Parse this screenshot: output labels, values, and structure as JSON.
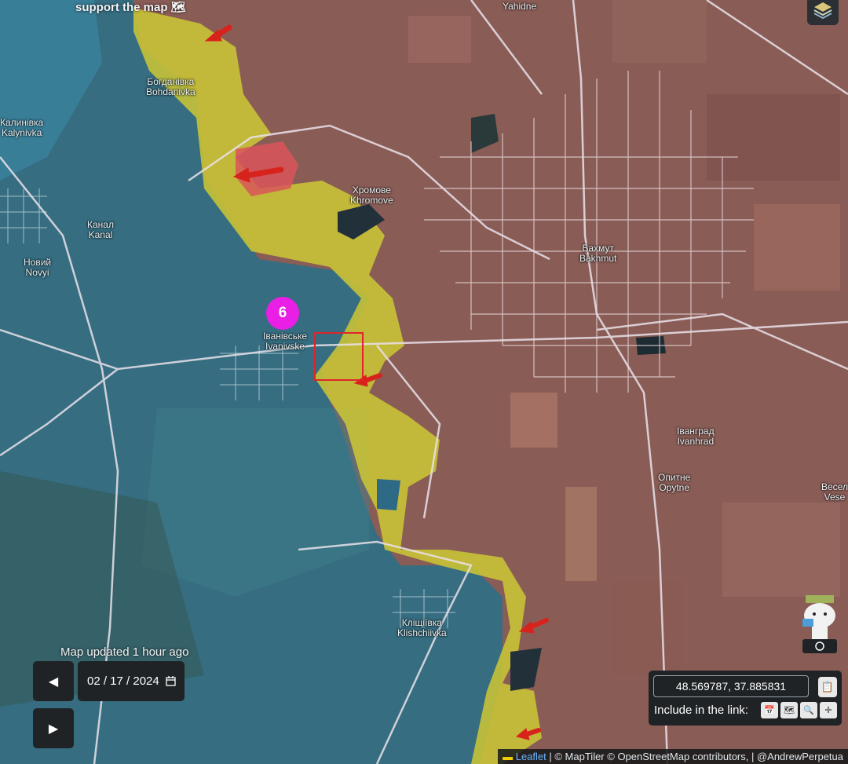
{
  "header_note": "support the map 🗺",
  "places": [
    {
      "id": "yahidne",
      "ua": "Yahidne",
      "en": ""
    },
    {
      "id": "bohdanivka",
      "ua": "Богданівка",
      "en": "Bohdanivka"
    },
    {
      "id": "kalynivka",
      "ua": "Калинівка",
      "en": "Kalynivka"
    },
    {
      "id": "khromove",
      "ua": "Хромове",
      "en": "Khromove"
    },
    {
      "id": "kanal",
      "ua": "Канал",
      "en": "Kanal"
    },
    {
      "id": "novyi",
      "ua": "Новий",
      "en": "Novyi"
    },
    {
      "id": "bakhmut",
      "ua": "Бахмут",
      "en": "Bakhmut"
    },
    {
      "id": "ivanivske",
      "ua": "Іванівське",
      "en": "Ivanivske"
    },
    {
      "id": "ivanhrad",
      "ua": "Іванград",
      "en": "Ivanhrad"
    },
    {
      "id": "opytne",
      "ua": "Опитне",
      "en": "Opytne"
    },
    {
      "id": "vesele",
      "ua": "Весел",
      "en": "Vese"
    },
    {
      "id": "klishchiivka",
      "ua": "Кліщіївка",
      "en": "Klishchiivka"
    }
  ],
  "marker_label": "6",
  "status": {
    "updated": "Map updated 1 hour ago"
  },
  "date_control": {
    "value": "02 / 17 / 2024",
    "prev_label": "◀",
    "next_label": "▶",
    "calendar_icon": "calendar-icon"
  },
  "coords": {
    "value": "48.569787, 37.885831",
    "include_label": "Include in the link:"
  },
  "attribution": {
    "leaflet": "Leaflet",
    "rest": " | © MapTiler © OpenStreetMap contributors, | @AndrewPerpetua"
  },
  "colors": {
    "ukraine_held": "#2f7e98",
    "contested": "#d8d430",
    "russia_held": "#a5545a",
    "attack_arrow": "#d8231c",
    "marker": "#e91fe6"
  }
}
